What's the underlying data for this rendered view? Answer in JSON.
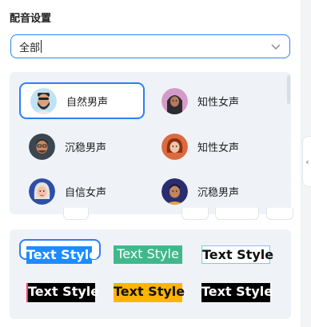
{
  "panel": {
    "title": "配音设置",
    "select": {
      "value": "全部"
    }
  },
  "voices": [
    {
      "label": "自然男声",
      "selected": true,
      "icon": "avatar-bearded-man"
    },
    {
      "label": "知性女声",
      "selected": false,
      "icon": "avatar-woman-hijab"
    },
    {
      "label": "沉稳男声",
      "selected": false,
      "icon": "avatar-man-glasses"
    },
    {
      "label": "知性女声",
      "selected": false,
      "icon": "avatar-woman-red-hair"
    },
    {
      "label": "自信女声",
      "selected": false,
      "icon": "avatar-woman-blonde"
    },
    {
      "label": "沉稳男声",
      "selected": false,
      "icon": "avatar-man-purple"
    }
  ],
  "text_styles": [
    {
      "label": "Text Style",
      "style": "blue-bg-white",
      "selected": true
    },
    {
      "label": "Text Style",
      "style": "green-bg-white",
      "selected": false
    },
    {
      "label": "Text Style",
      "style": "outline-cyan-black",
      "selected": false
    },
    {
      "label": "Text Style",
      "style": "black-bg-white-glitch",
      "selected": false
    },
    {
      "label": "Text Style",
      "style": "yellow-bg-black",
      "selected": false
    },
    {
      "label": "Text Style",
      "style": "black-bg-white",
      "selected": false
    }
  ],
  "colors": {
    "accent": "#2d7ff9",
    "panel_bg": "#eff3f8",
    "style_blue": "#1e8bff",
    "style_green": "#3fb98b",
    "style_yellow": "#ffb400"
  }
}
